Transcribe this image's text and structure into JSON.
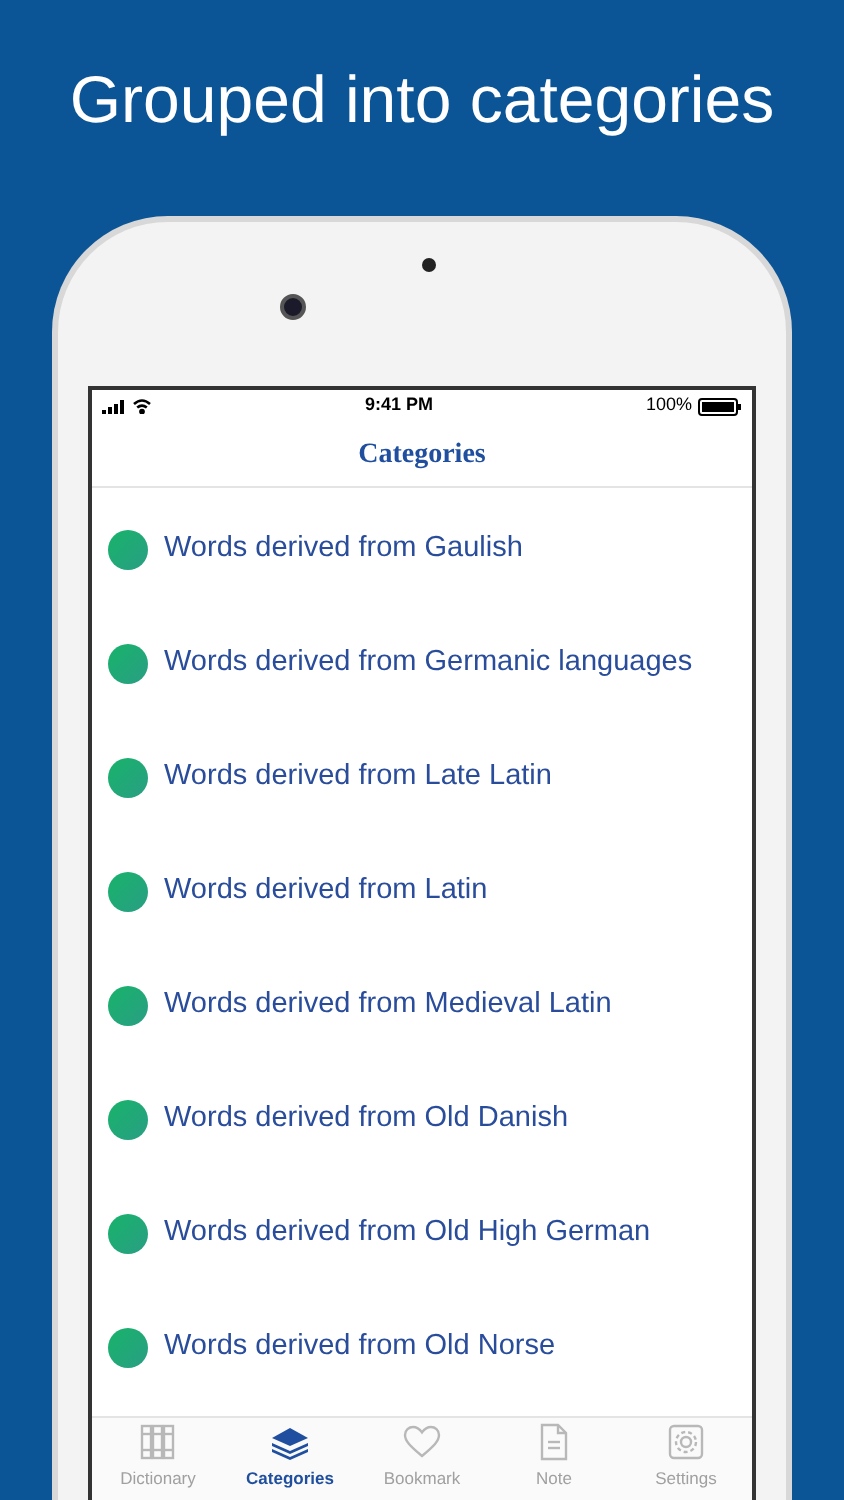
{
  "headline": "Grouped into categories",
  "status_bar": {
    "time": "9:41 PM",
    "battery": "100%"
  },
  "nav": {
    "title": "Categories"
  },
  "categories": [
    {
      "label": "Words derived from Gaulish"
    },
    {
      "label": "Words derived from Germanic languages"
    },
    {
      "label": "Words derived from Late Latin"
    },
    {
      "label": "Words derived from Latin"
    },
    {
      "label": "Words derived from Medieval Latin"
    },
    {
      "label": "Words derived from Old Danish"
    },
    {
      "label": "Words derived from Old High German"
    },
    {
      "label": "Words derived from Old Norse"
    }
  ],
  "tabs": [
    {
      "label": "Dictionary",
      "selected": false
    },
    {
      "label": "Categories",
      "selected": true
    },
    {
      "label": "Bookmark",
      "selected": false
    },
    {
      "label": "Note",
      "selected": false
    },
    {
      "label": "Settings",
      "selected": false
    }
  ]
}
